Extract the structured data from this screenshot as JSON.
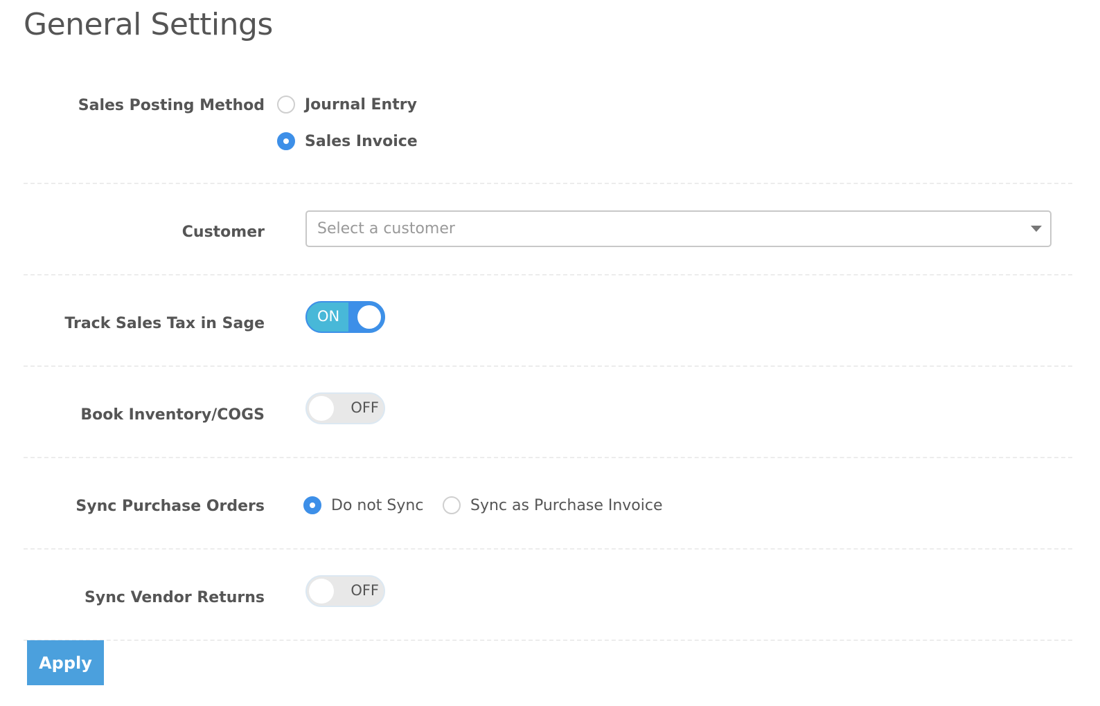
{
  "page": {
    "title": "General Settings"
  },
  "colors": {
    "accent": "#3d8fe8",
    "toggle_on": "#48b8d8",
    "apply": "#4ba0dd"
  },
  "settings": {
    "sales_posting_method": {
      "label": "Sales Posting Method",
      "options": [
        {
          "label": "Journal Entry",
          "checked": false
        },
        {
          "label": "Sales Invoice",
          "checked": true
        }
      ]
    },
    "customer": {
      "label": "Customer",
      "placeholder": "Select a customer",
      "value": "",
      "icon": "chevron-down-icon"
    },
    "track_sales_tax": {
      "label": "Track Sales Tax in Sage",
      "state": "ON"
    },
    "book_inventory": {
      "label": "Book Inventory/COGS",
      "state": "OFF"
    },
    "sync_purchase_orders": {
      "label": "Sync Purchase Orders",
      "options": [
        {
          "label": "Do not Sync",
          "checked": true
        },
        {
          "label": "Sync as Purchase Invoice",
          "checked": false
        }
      ]
    },
    "sync_vendor_returns": {
      "label": "Sync Vendor Returns",
      "state": "OFF"
    }
  },
  "actions": {
    "apply_label": "Apply"
  }
}
